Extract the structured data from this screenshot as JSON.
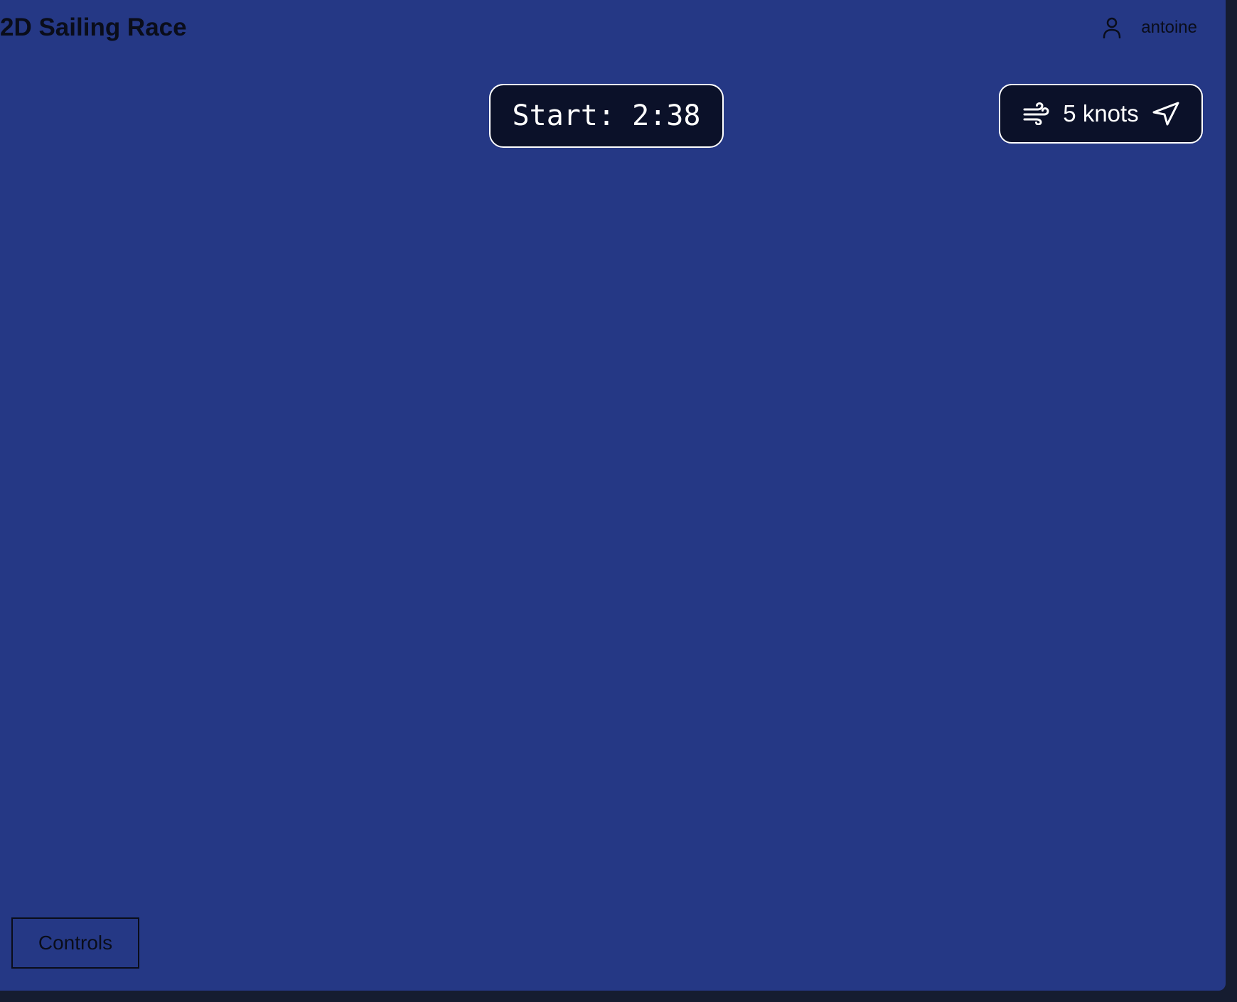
{
  "header": {
    "title": "2D Sailing Race",
    "user": {
      "icon": "user-icon",
      "name": "antoine"
    }
  },
  "race": {
    "start_timer": "Start: 2:38"
  },
  "wind": {
    "speed_label": "5 knots",
    "wind_icon": "wind-icon",
    "direction_icon": "navigation-arrow-icon"
  },
  "controls": {
    "button_label": "Controls"
  },
  "colors": {
    "water": "#253885",
    "panel": "#0b1129",
    "outside": "#151c30"
  }
}
